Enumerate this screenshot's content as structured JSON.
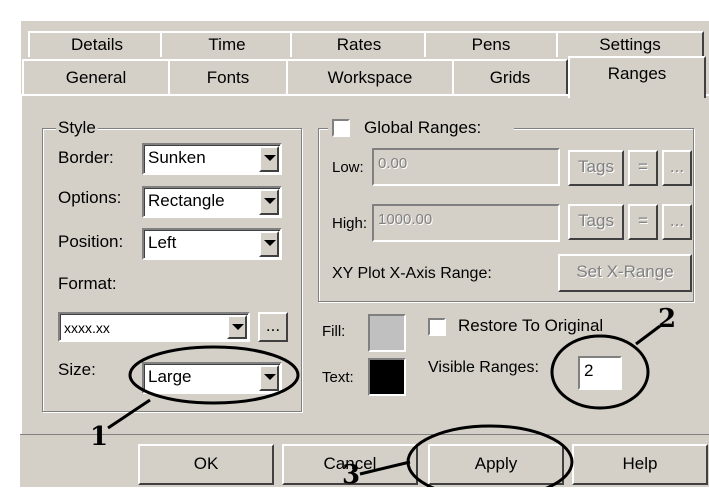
{
  "tabs_row1": [
    "Details",
    "Time",
    "Rates",
    "Pens",
    "Settings"
  ],
  "tabs_row2": [
    "General",
    "Fonts",
    "Workspace",
    "Grids",
    "Ranges"
  ],
  "style_group": {
    "title": "Style",
    "border_label": "Border:",
    "border_value": "Sunken",
    "options_label": "Options:",
    "options_value": "Rectangle",
    "position_label": "Position:",
    "position_value": "Left",
    "format_label": "Format:",
    "format_value": "xxxx.xx",
    "format_button": "...",
    "size_label": "Size:",
    "size_value": "Large"
  },
  "global_ranges": {
    "title": "Global Ranges:",
    "low_label": "Low:",
    "low_value": "0.00",
    "high_label": "High:",
    "high_value": "1000.00",
    "tags_label": "Tags",
    "equals_label": "=",
    "more_label": "...",
    "xy_label": "XY Plot X-Axis Range:",
    "set_x_range": "Set X-Range"
  },
  "colors": {
    "fill_label": "Fill:",
    "fill_color": "#c0c0c0",
    "text_label": "Text:",
    "text_color": "#000000"
  },
  "restore_label": "Restore To Original",
  "visible_ranges_label": "Visible Ranges:",
  "visible_ranges_value": "2",
  "buttons": {
    "ok": "OK",
    "cancel": "Cancel",
    "apply": "Apply",
    "help": "Help"
  },
  "callouts": [
    "1",
    "2",
    "3"
  ]
}
